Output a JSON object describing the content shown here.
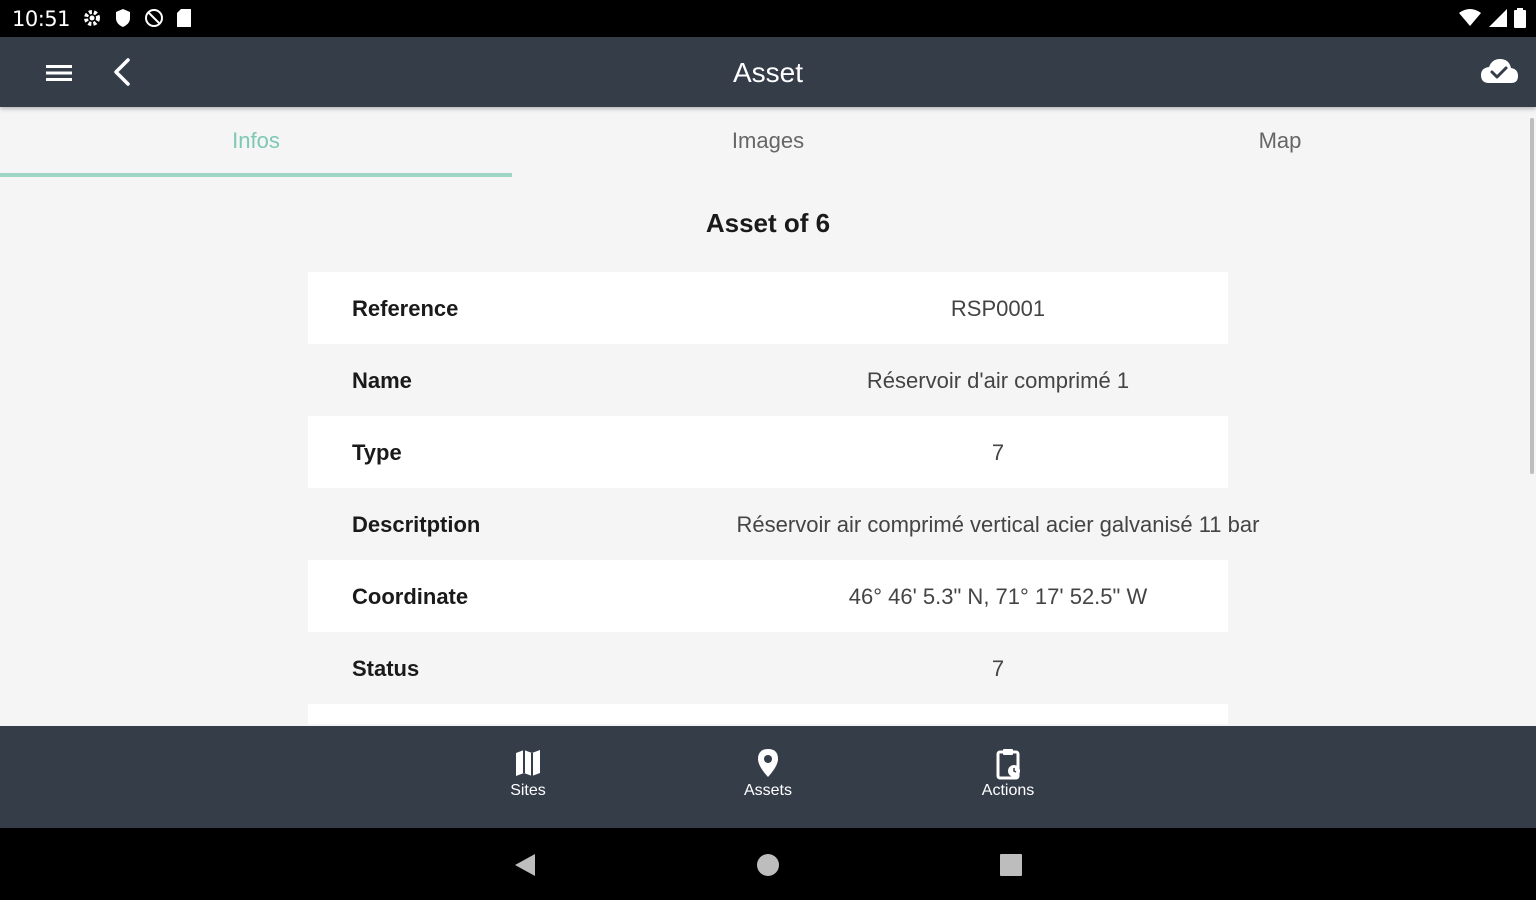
{
  "status_bar": {
    "time": "10:51",
    "left_icons": [
      "settings-icon",
      "shield-icon",
      "no-signal-icon",
      "sd-card-icon"
    ],
    "right_icons": [
      "wifi-icon",
      "cell-signal-icon",
      "battery-icon"
    ]
  },
  "app_bar": {
    "title": "Asset",
    "menu_icon": "menu-icon",
    "back_icon": "back-arrow-icon",
    "sync_icon": "cloud-done-icon"
  },
  "tabs": [
    {
      "label": "Infos",
      "active": true
    },
    {
      "label": "Images",
      "active": false
    },
    {
      "label": "Map",
      "active": false
    }
  ],
  "section_title": "Asset of 6",
  "rows": [
    {
      "label": "Reference",
      "value": "RSP0001"
    },
    {
      "label": "Name",
      "value": "Réservoir d'air comprimé 1"
    },
    {
      "label": "Type",
      "value": "7"
    },
    {
      "label": "Descritption",
      "value": "Réservoir air comprimé vertical acier galvanisé 11 bar"
    },
    {
      "label": "Coordinate",
      "value": "46° 46' 5.3\" N, 71° 17' 52.5\" W"
    },
    {
      "label": "Status",
      "value": "7"
    }
  ],
  "bottom_nav": [
    {
      "label": "Sites",
      "icon": "map-icon"
    },
    {
      "label": "Assets",
      "icon": "location-pin-icon"
    },
    {
      "label": "Actions",
      "icon": "clipboard-icon"
    }
  ],
  "colors": {
    "app_bar": "#353d49",
    "accent": "#7ec8b4",
    "background": "#f5f5f5"
  }
}
